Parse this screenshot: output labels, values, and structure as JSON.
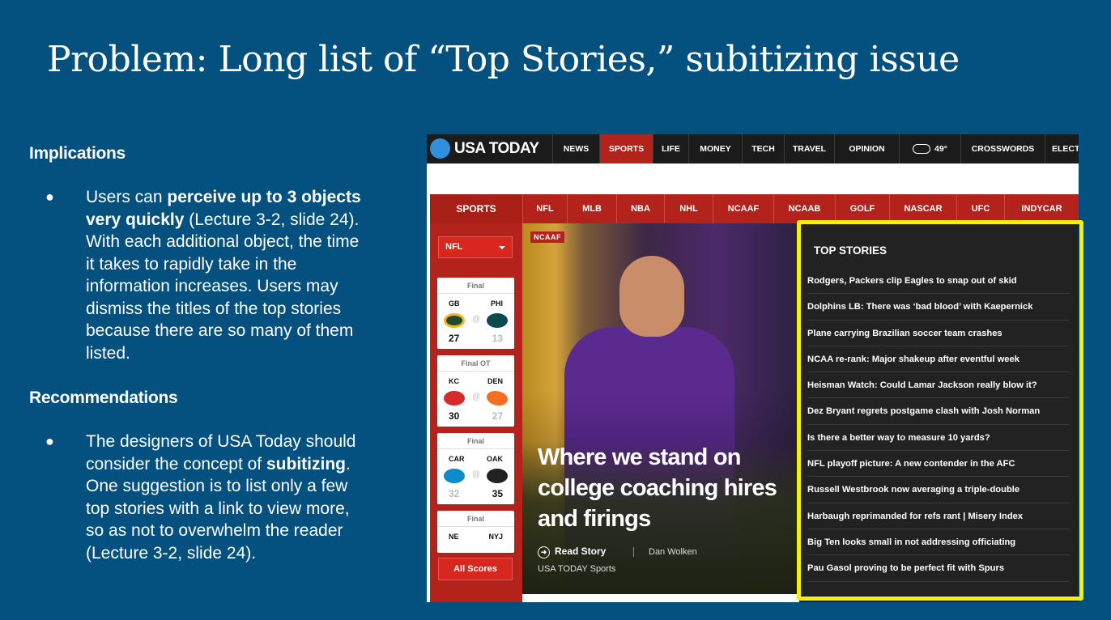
{
  "slide": {
    "title": "Problem: Long list of “Top Stories,” subitizing issue",
    "implications_heading": "Implications",
    "implications_bullet": {
      "t1": "Users can ",
      "b1": "perceive up to 3 objects very quickly",
      "t2": " (Lecture 3-2, slide 24). With each additional object, the time it takes to rapidly take in the information increases. Users may dismiss the titles of the top stories because there are so many of them listed."
    },
    "recommendations_heading": "Recommendations",
    "recommendations_bullet": {
      "t1": "The designers of USA Today should consider the concept of ",
      "b1": "subitizing",
      "t2": ". One suggestion is to list only a few top stories with a link to view more, so as not to overwhelm the reader (Lecture 3-2, slide 24)."
    },
    "bullet_glyph": "●"
  },
  "screenshot": {
    "logo_text": "USA TODAY",
    "top_nav": [
      "NEWS",
      "SPORTS",
      "LIFE",
      "MONEY",
      "TECH",
      "TRAVEL",
      "OPINION"
    ],
    "weather_temp": "49°",
    "crosswords": "CROSSWORDS",
    "elections": "ELECTI",
    "sports_label": "SPORTS",
    "sport_nav": [
      "NFL",
      "MLB",
      "NBA",
      "NHL",
      "NCAAF",
      "NCAAB",
      "GOLF",
      "NASCAR",
      "UFC",
      "INDYCAR"
    ],
    "league_select": "NFL",
    "scores": [
      {
        "status": "Final",
        "team1": "GB",
        "team2": "PHI",
        "score1": "27",
        "score2": "13"
      },
      {
        "status": "Final OT",
        "team1": "KC",
        "team2": "DEN",
        "score1": "30",
        "score2": "27"
      },
      {
        "status": "Final",
        "team1": "CAR",
        "team2": "OAK",
        "score1": "32",
        "score2": "35"
      },
      {
        "status": "Final",
        "team1": "NE",
        "team2": "NYJ",
        "score1": "",
        "score2": ""
      }
    ],
    "all_scores": "All Scores",
    "hero": {
      "tag": "NCAAF",
      "headline": "Where we stand on college coaching hires and firings",
      "read_story": "Read Story",
      "author": "Dan Wolken",
      "source": "USA TODAY Sports"
    },
    "top_stories_heading": "TOP STORIES",
    "top_stories": [
      "Rodgers, Packers clip Eagles to snap out of skid",
      "Dolphins LB: There was ‘bad blood’ with Kaepernick",
      "Plane carrying Brazilian soccer team crashes",
      "NCAA re-rank: Major shakeup after eventful week",
      "Heisman Watch: Could Lamar Jackson really blow it?",
      "Dez Bryant regrets postgame clash with Josh Norman",
      "Is there a better way to measure 10 yards?",
      "NFL playoff picture: A new contender in the AFC",
      "Russell Westbrook now averaging a triple-double",
      "Harbaugh reprimanded for refs rant  | Misery Index",
      "Big Ten looks small in not addressing officiating",
      "Pau Gasol proving to be perfect fit with Spurs"
    ]
  },
  "colors": {
    "slide_bg": "#04507e",
    "usa_today_red": "#b3221b",
    "highlight_yellow": "#f5f00a",
    "logo_blue": "#2f91de"
  }
}
